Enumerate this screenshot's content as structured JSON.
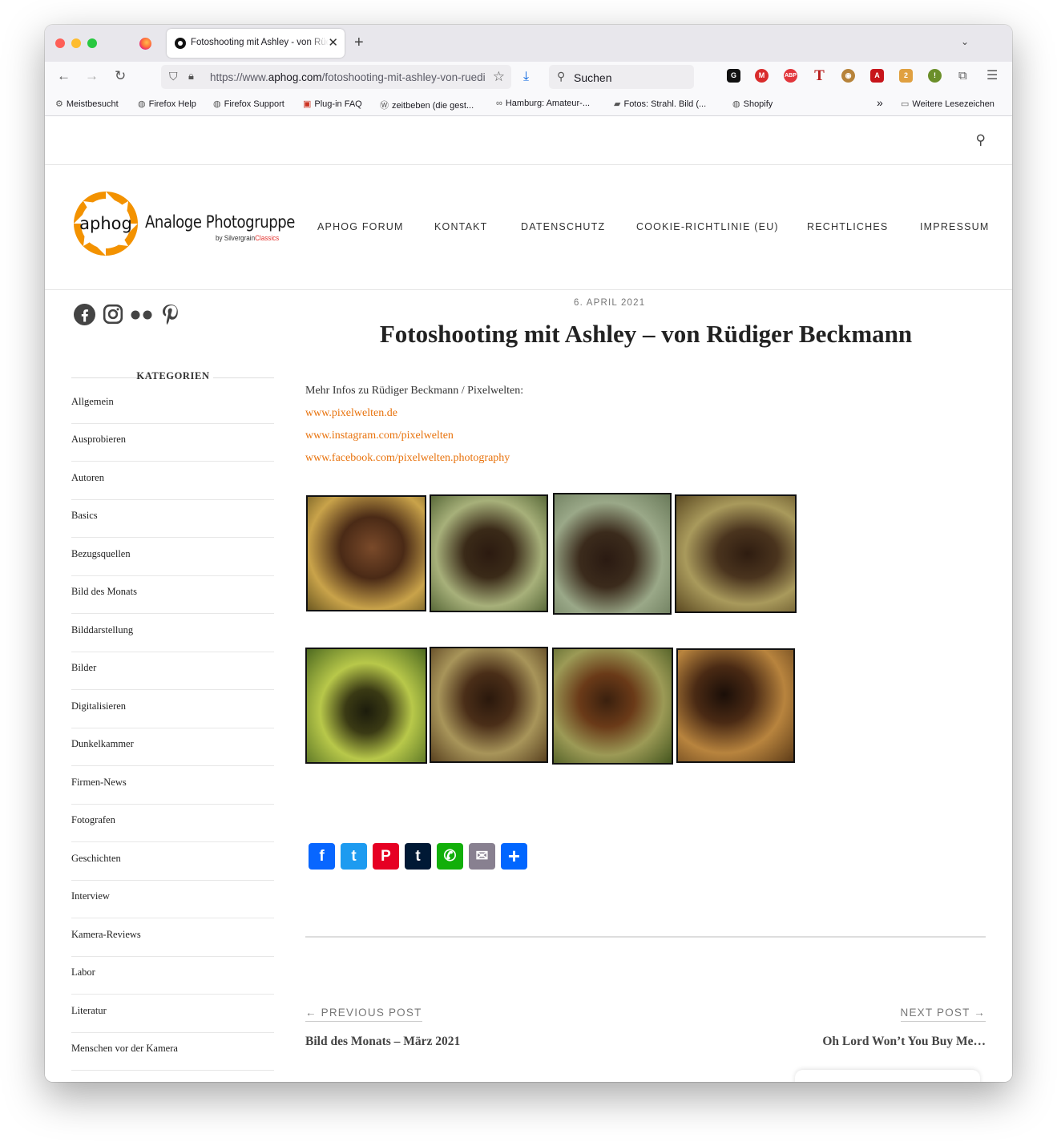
{
  "browser": {
    "tab_title": "Fotoshooting mit Ashley - von Rüdiger Beckmann",
    "url_prefix": "https://www.",
    "url_domain": "aphog.com",
    "url_path": "/fotoshooting-mit-ashley-von-ruediger-beckmann/",
    "search_placeholder": "Suchen",
    "bookmarks": [
      "Meistbesucht",
      "Firefox Help",
      "Firefox Support",
      "Plug-in FAQ",
      "zeitbeben (die gest...",
      "Hamburg: Amateur-...",
      "Fotos: Strahl. Bild (...",
      "Shopify"
    ],
    "more_bookmarks": "Weitere Lesezeichen",
    "ext_badges": [
      "2",
      "!"
    ]
  },
  "site": {
    "logo_word": "aphog",
    "logo_name": "Analoge Photogruppe",
    "logo_by": "by Silvergrain",
    "logo_by_accent": "Classics",
    "menu": [
      "APHOG FORUM",
      "KONTAKT",
      "DATENSCHUTZ",
      "COOKIE-RICHTLINIE (EU)",
      "RECHTLICHES",
      "IMPRESSUM"
    ]
  },
  "sidebar": {
    "social": [
      "facebook-icon",
      "instagram-icon",
      "flickr-icon",
      "pinterest-icon"
    ],
    "categories_title": "KATEGORIEN",
    "categories": [
      "Allgemein",
      "Ausprobieren",
      "Autoren",
      "Basics",
      "Bezugsquellen",
      "Bild des Monats",
      "Bilddarstellung",
      "Bilder",
      "Digitalisieren",
      "Dunkelkammer",
      "Firmen-News",
      "Fotografen",
      "Geschichten",
      "Interview",
      "Kamera-Reviews",
      "Labor",
      "Literatur",
      "Menschen vor der Kamera"
    ]
  },
  "post": {
    "date": "6. APRIL 2021",
    "title": "Fotoshooting mit Ashley – von Rüdiger Beckmann",
    "intro": "Mehr Infos zu Rüdiger Beckmann / Pixelwelten:",
    "links": [
      "www.pixelwelten.de",
      "www.instagram.com/pixelwelten",
      "www.facebook.com/pixelwelten.photography"
    ],
    "share_buttons": [
      {
        "name": "Facebook",
        "glyph": "f",
        "color": "#0866ff"
      },
      {
        "name": "Twitter",
        "glyph": "t",
        "color": "#1d9bf0"
      },
      {
        "name": "Pinterest",
        "glyph": "P",
        "color": "#e60023"
      },
      {
        "name": "Tumblr",
        "glyph": "t",
        "color": "#001935"
      },
      {
        "name": "WhatsApp",
        "glyph": "✆",
        "color": "#12af0a"
      },
      {
        "name": "Email",
        "glyph": "✉",
        "color": "#888090"
      },
      {
        "name": "Share",
        "glyph": "+",
        "color": "#0166ff"
      }
    ],
    "prev_label": "← PREVIOUS POST",
    "prev_title": "Bild des Monats – März 2021",
    "next_label": "NEXT POST →",
    "next_title": "Oh Lord Won’t You Buy Me…"
  }
}
